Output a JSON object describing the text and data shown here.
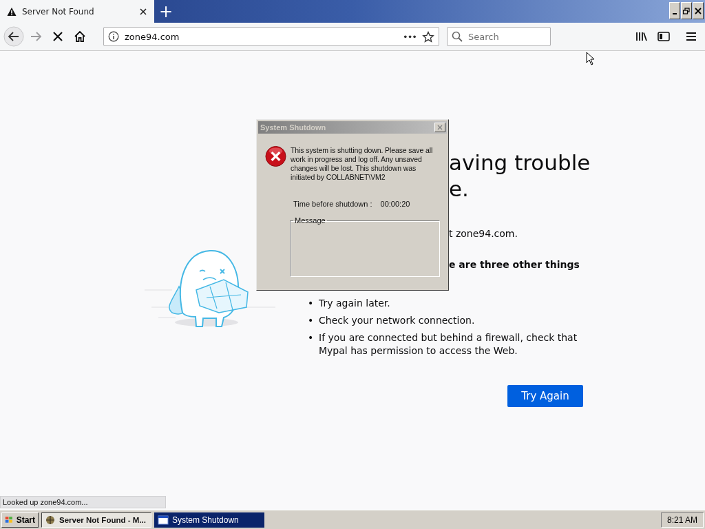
{
  "browser": {
    "tabs": [
      {
        "title": "Server Not Found",
        "selected": true
      }
    ],
    "new_tab": "+",
    "forward_disabled": true,
    "url": "zone94.com",
    "page_actions": "•••",
    "search": {
      "placeholder": "Search"
    }
  },
  "error_page": {
    "heading_lines": [
      "aving trouble",
      "e."
    ],
    "message": "t zone94.com.",
    "lead": "e are three other things",
    "bullets": [
      {
        "marker": "•",
        "text": "Try again later."
      },
      {
        "marker": "•",
        "text": "Check your network connection."
      },
      {
        "marker": "•",
        "text": "If you are connected but behind a firewall, check that Mypal has permission to access the Web."
      }
    ],
    "button": "Try Again"
  },
  "dialog": {
    "title": "System Shutdown",
    "message": "This system is shutting down. Please save all work in progress and log off. Any unsaved changes will be lost. This shutdown was initiated by COLLABNET\\VM2",
    "time_label": "Time before shutdown :",
    "time_value": "00:00:20",
    "group_label": "Message"
  },
  "status_text": "Looked up zone94.com...",
  "taskbar": {
    "start": "Start",
    "items": [
      {
        "label": "Server Not Found - M...",
        "selected": false
      },
      {
        "label": "System Shutdown",
        "selected": true
      }
    ],
    "clock": "8:21 AM"
  }
}
